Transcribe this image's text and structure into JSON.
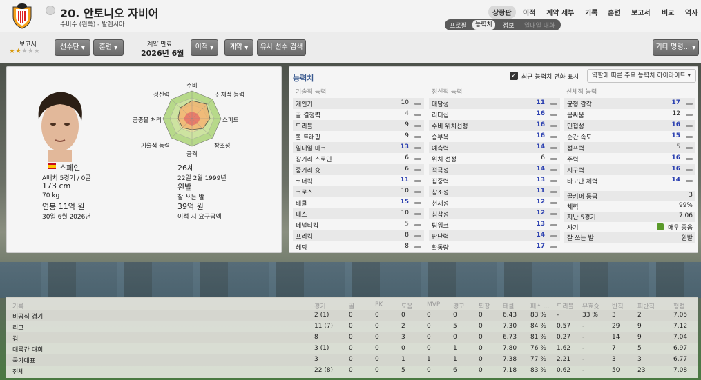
{
  "header": {
    "player_name": "20. 안토니오 자비어",
    "player_sub": "수비수 (왼쪽) - 발렌시아",
    "nav": [
      "상황판",
      "이적",
      "계약 세부",
      "기록",
      "훈련",
      "보고서",
      "비교",
      "역사"
    ],
    "subnav": [
      "프로필",
      "능력치",
      "정보",
      "일대일 대화"
    ]
  },
  "toolbar": {
    "report_label": "보고서",
    "squad_button": "선수단",
    "training_button": "훈련",
    "contract_end_label": "계약 만료",
    "contract_end_value": "2026년 6월",
    "transfer_button": "이적",
    "contract_button": "계약",
    "similar_button": "유사 선수 검색",
    "other_button": "기타 명령..."
  },
  "profile": {
    "radar": [
      "수비",
      "신체적 능력",
      "스피드",
      "창조성",
      "공격",
      "기술적 능력",
      "공중볼 처리",
      "정신력"
    ],
    "nation": "스페인",
    "caps": "A매치 5경기 / 0골",
    "height": "173 cm",
    "weight": "70 kg",
    "wage": "연봉 11억 원",
    "contract_date": "30일 6월 2026년",
    "age": "26세",
    "dob": "22일 2월 1999년",
    "foot": "왼발",
    "foot_label": "잘 쓰는 발",
    "value": "39억 원",
    "value_label": "이적 시 요구금액"
  },
  "attributes": {
    "title": "능력치",
    "show_changes": "최근 능력치 변화 표시",
    "highlight": "역할에 따른 주요 능력치 하이라이트",
    "col_headers": [
      "기술적 능력",
      "정신적 능력",
      "신체적 능력"
    ],
    "technical": [
      [
        "개인기",
        "10"
      ],
      [
        "골 결정력",
        "4"
      ],
      [
        "드리블",
        "9"
      ],
      [
        "볼 트래핑",
        "9"
      ],
      [
        "일대일 마크",
        "13"
      ],
      [
        "장거리 스로인",
        "6"
      ],
      [
        "중거리 슛",
        "6"
      ],
      [
        "코너킥",
        "11"
      ],
      [
        "크로스",
        "10"
      ],
      [
        "태클",
        "15"
      ],
      [
        "패스",
        "10"
      ],
      [
        "페널티킥",
        "5"
      ],
      [
        "프리킥",
        "8"
      ],
      [
        "헤딩",
        "8"
      ]
    ],
    "mental": [
      [
        "대담성",
        "11"
      ],
      [
        "리더십",
        "16"
      ],
      [
        "수비 위치선정",
        "16"
      ],
      [
        "승부욕",
        "16"
      ],
      [
        "예측력",
        "14"
      ],
      [
        "위치 선정",
        "6"
      ],
      [
        "적극성",
        "14"
      ],
      [
        "집중력",
        "13"
      ],
      [
        "창조성",
        "11"
      ],
      [
        "천재성",
        "12"
      ],
      [
        "침착성",
        "12"
      ],
      [
        "팀워크",
        "13"
      ],
      [
        "판단력",
        "14"
      ],
      [
        "활동량",
        "17"
      ]
    ],
    "physical": [
      [
        "균형 감각",
        "17"
      ],
      [
        "몸싸움",
        "12"
      ],
      [
        "민첩성",
        "16"
      ],
      [
        "순간 속도",
        "15"
      ],
      [
        "점프력",
        "5"
      ],
      [
        "주력",
        "16"
      ],
      [
        "지구력",
        "16"
      ],
      [
        "타고난 체력",
        "14"
      ]
    ],
    "extra": [
      [
        "골키퍼 등급",
        "3"
      ],
      [
        "체력",
        "99%"
      ],
      [
        "지난 5경기",
        "7.06"
      ],
      [
        "사기",
        "매우 좋음"
      ],
      [
        "잘 쓰는 발",
        "왼발"
      ]
    ]
  },
  "stats": {
    "headers": [
      "기록",
      "경기",
      "골",
      "PK",
      "도움",
      "MVP",
      "경고",
      "퇴장",
      "태클",
      "패스 ...",
      "드리블",
      "유효슛",
      "반칙",
      "피반칙",
      "평점"
    ],
    "rows": [
      [
        "비공식 경기",
        "2 (1)",
        "0",
        "0",
        "0",
        "0",
        "0",
        "0",
        "6.43",
        "83 %",
        "-",
        "33 %",
        "3",
        "2",
        "7.05"
      ],
      [
        "리그",
        "11 (7)",
        "0",
        "0",
        "2",
        "0",
        "5",
        "0",
        "7.30",
        "84 %",
        "0.57",
        "-",
        "29",
        "9",
        "7.12"
      ],
      [
        "컵",
        "8",
        "0",
        "0",
        "3",
        "0",
        "0",
        "0",
        "6.73",
        "81 %",
        "0.27",
        "-",
        "14",
        "9",
        "7.04"
      ],
      [
        "대륙간 대회",
        "3 (1)",
        "0",
        "0",
        "0",
        "0",
        "1",
        "0",
        "7.80",
        "76 %",
        "1.62",
        "-",
        "7",
        "5",
        "6.97"
      ],
      [
        "국가대표",
        "3",
        "0",
        "0",
        "1",
        "1",
        "1",
        "0",
        "7.38",
        "77 %",
        "2.21",
        "-",
        "3",
        "3",
        "6.77"
      ],
      [
        "전체",
        "22 (8)",
        "0",
        "0",
        "5",
        "0",
        "6",
        "0",
        "7.18",
        "83 %",
        "0.62",
        "-",
        "50",
        "23",
        "7.08"
      ]
    ]
  },
  "colors": {
    "accent": "#3a5a90",
    "value_blue": "#2a3fb0",
    "morale_green": "#5a9a2a"
  }
}
